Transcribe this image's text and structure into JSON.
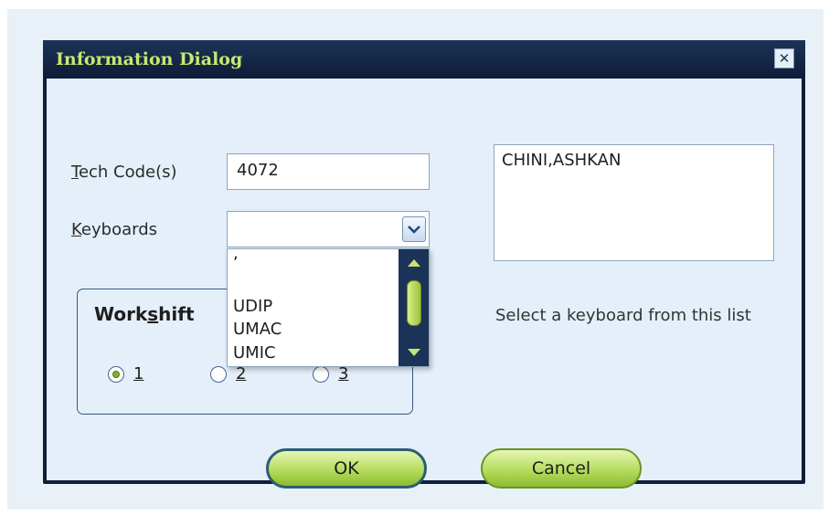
{
  "dialog": {
    "title": "Information Dialog",
    "close_symbol": "✕"
  },
  "tech_code": {
    "label_mnemonic": "T",
    "label_rest": "ech Code(s)",
    "value": "4072"
  },
  "keyboards": {
    "label_mnemonic": "K",
    "label_rest": "eyboards",
    "selected": "",
    "options_visible": [
      ",",
      "",
      "UDIP",
      "UMAC",
      "UMIC"
    ]
  },
  "name_box": {
    "value": "CHINI,ASHKAN"
  },
  "hint": {
    "text": "Select a keyboard from this list"
  },
  "workshift": {
    "title_pre": "Work",
    "title_mnemonic": "s",
    "title_post": "hift",
    "options": [
      {
        "label": "1",
        "checked": true
      },
      {
        "label": "2",
        "checked": false
      },
      {
        "label": "3",
        "checked": false
      }
    ]
  },
  "buttons": {
    "ok_label": "OK",
    "cancel_label": "Cancel"
  },
  "colors": {
    "title_text": "#c9e86f",
    "title_bar": "#0e1d36",
    "button_green": "#b5dc5e",
    "panel_bg": "#e4eff9"
  },
  "icons": {
    "close": "close-icon",
    "dropdown": "chevron-down-icon",
    "scroll_up": "arrow-up-icon",
    "scroll_down": "arrow-down-icon"
  }
}
